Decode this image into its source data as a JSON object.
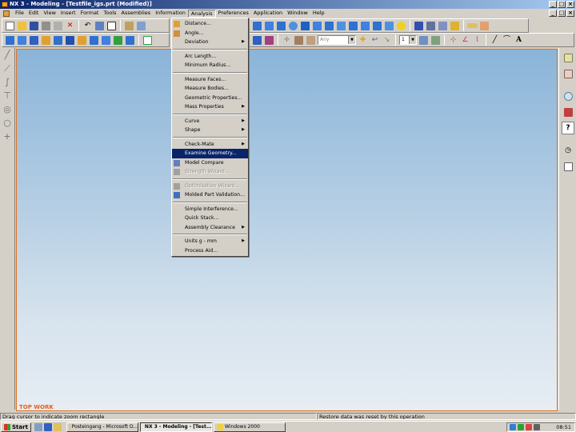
{
  "window": {
    "title": "NX 3 - Modeling - [Testfile_igs.prt (Modified)]",
    "min": "_",
    "max": "□",
    "close": "×"
  },
  "menubar": {
    "items": [
      "File",
      "Edit",
      "View",
      "Insert",
      "Format",
      "Tools",
      "Assemblies",
      "Information",
      "Analysis",
      "Preferences",
      "Application",
      "Window",
      "Help"
    ],
    "active": "Analysis"
  },
  "toolbar": {
    "combo1": "Any",
    "combo2": "1"
  },
  "analysis_menu": {
    "items": [
      {
        "label": "Distance...",
        "icon": "distance-icon",
        "submenu": false
      },
      {
        "label": "Angle...",
        "icon": "angle-icon",
        "submenu": false
      },
      {
        "label": "Deviation",
        "submenu": true
      },
      {
        "sep": true
      },
      {
        "label": "Arc Length...",
        "submenu": false
      },
      {
        "label": "Minimum Radius...",
        "submenu": false
      },
      {
        "sep": true
      },
      {
        "label": "Measure Faces...",
        "submenu": false
      },
      {
        "label": "Measure Bodies...",
        "submenu": false
      },
      {
        "label": "Geometric Properties...",
        "submenu": false
      },
      {
        "label": "Mass Properties",
        "submenu": true
      },
      {
        "sep": true
      },
      {
        "label": "Curve",
        "submenu": true
      },
      {
        "label": "Shape",
        "submenu": true
      },
      {
        "sep": true
      },
      {
        "label": "Check-Mate",
        "submenu": true
      },
      {
        "label": "Examine Geometry...",
        "submenu": false,
        "highlighted": true
      },
      {
        "label": "Model Compare",
        "icon": "model-compare-icon",
        "submenu": false
      },
      {
        "label": "Strength Wizard...",
        "icon": "strength-wizard-icon",
        "submenu": false,
        "disabled": true
      },
      {
        "sep": true
      },
      {
        "label": "Optimization Wizard...",
        "icon": "optimization-wizard-icon",
        "submenu": false,
        "disabled": true
      },
      {
        "label": "Molded Part Validation...",
        "icon": "molded-part-icon",
        "submenu": false
      },
      {
        "sep": true
      },
      {
        "label": "Simple Interference...",
        "submenu": false
      },
      {
        "label": "Quick Stack...",
        "submenu": false
      },
      {
        "label": "Assembly Clearance",
        "submenu": true
      },
      {
        "sep": true
      },
      {
        "label": "Units g - mm",
        "submenu": true
      },
      {
        "label": "Process Aid...",
        "submenu": false
      }
    ]
  },
  "viewport": {
    "view_label": "TOP WORK"
  },
  "status": {
    "left": "Drag cursor to indicate zoom rectangle",
    "right": "Restore data was reset by this operation"
  },
  "taskbar": {
    "start": "Start",
    "tasks": [
      "Posteingang - Microsoft O...",
      "NX 3 - Modeling - [Test...",
      "Windows 2000"
    ],
    "active_task": 1,
    "clock": "08:51"
  }
}
